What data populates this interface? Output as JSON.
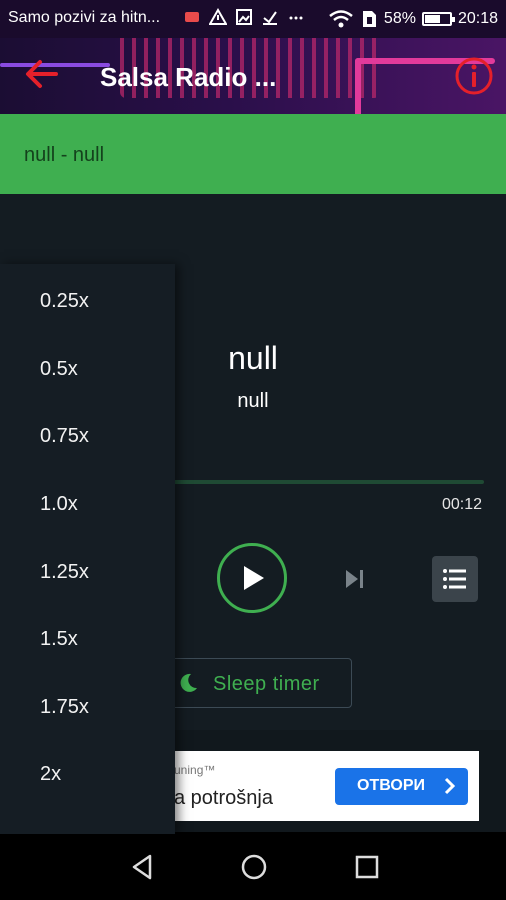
{
  "status_bar": {
    "carrier_text": "Samo pozivi za hitn...",
    "battery": "58%",
    "time": "20:18",
    "battery_level": 0.58,
    "icons": [
      "messages-icon",
      "warning-icon",
      "image-icon",
      "download-icon",
      "more-icon",
      "wifi-icon",
      "sim-icon",
      "battery-icon"
    ]
  },
  "app_bar": {
    "title": "Salsa Radio ...",
    "back_icon": "arrow-left-icon",
    "info_icon": "info-icon",
    "accent": "#e5202a"
  },
  "now_playing_banner": {
    "text": "null - null"
  },
  "player": {
    "title": "null",
    "subtitle": "null",
    "time": "00:12",
    "progress": 0.0,
    "sleep_timer_label": "Sleep timer",
    "accent": "#3faf50"
  },
  "speed_menu": {
    "options": [
      "0.25x",
      "0.5x",
      "0.75x",
      "1.0x",
      "1.25x",
      "1.5x",
      "1.75x",
      "2x"
    ]
  },
  "ad": {
    "top_text": "uning™",
    "main_text": "a potrošnja",
    "button_label": "ОТВОРИ",
    "button_color": "#1a73e8"
  },
  "nav_bar": {
    "icons": [
      "back-triangle-icon",
      "home-circle-icon",
      "recents-square-icon"
    ]
  }
}
